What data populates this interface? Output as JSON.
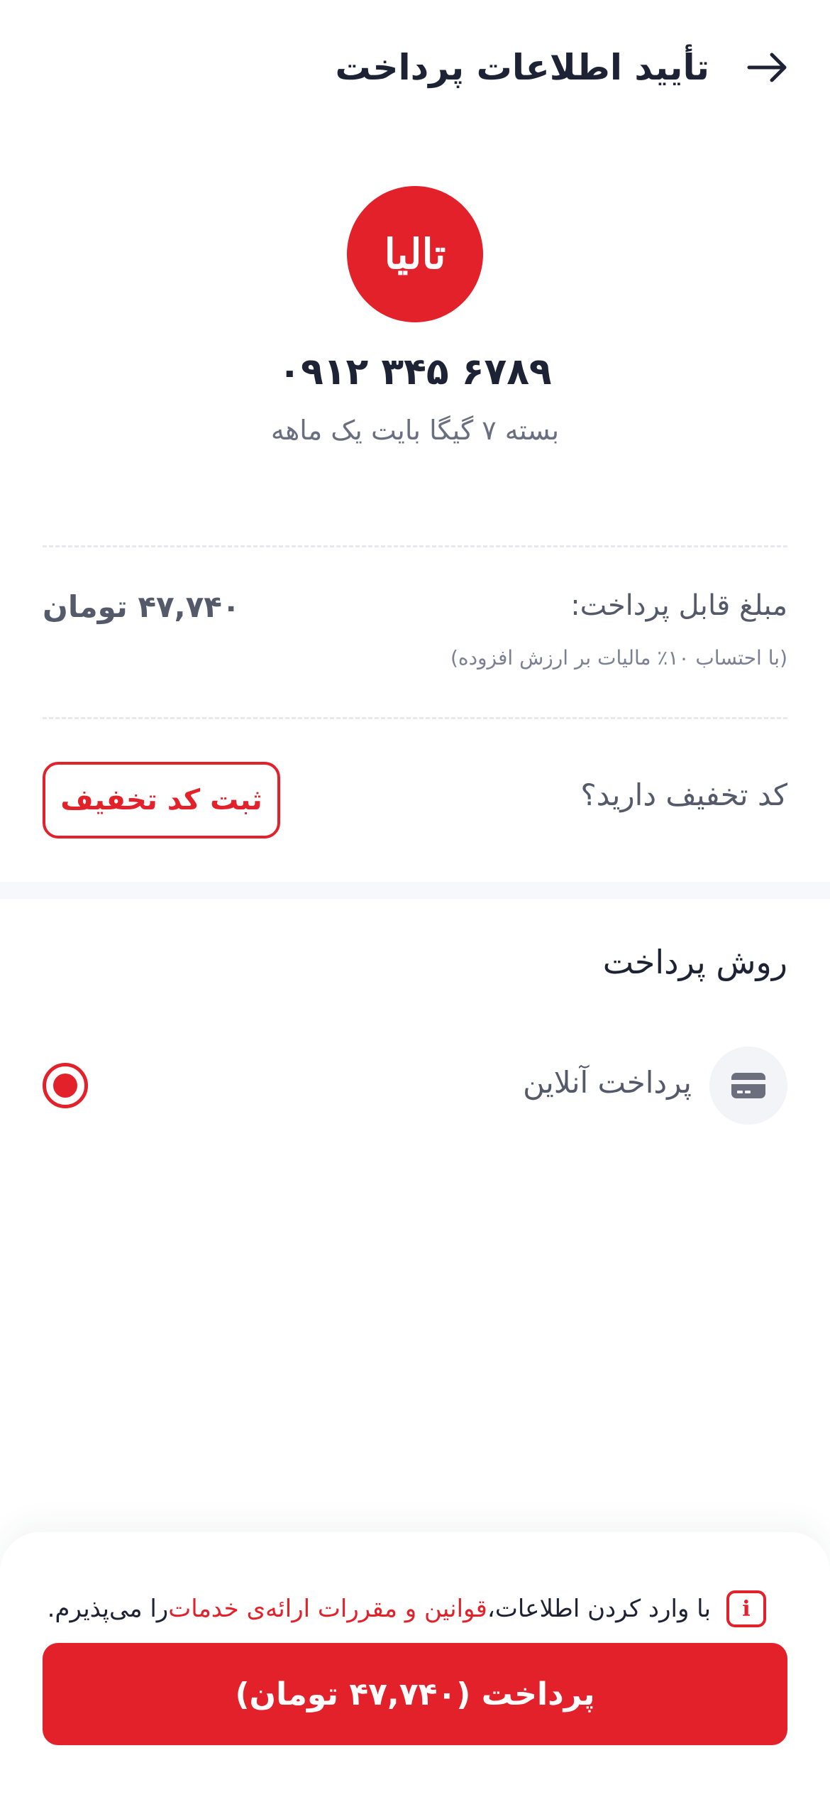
{
  "header": {
    "title": "تأیید اطلاعات پرداخت",
    "back_icon": "arrow-right-icon"
  },
  "operator": {
    "logo_text": "تالیا",
    "logo_color": "#e3212b",
    "phone": "۰۹۱۲ ۳۴۵ ۶۷۸۹",
    "package": "بسته ۷ گیگا بایت یک ماهه"
  },
  "amount": {
    "label": "مبلغ قابل پرداخت:",
    "value": "۴۷,۷۴۰ تومان",
    "note": "(با احتساب ۱۰٪ مالیات بر ارزش افزوده)"
  },
  "discount": {
    "question": "کد تخفیف دارید؟",
    "button_label": "ثبت کد تخفیف"
  },
  "payment_method": {
    "title": "روش پرداخت",
    "option_label": "پرداخت آنلاین",
    "option_icon": "credit-card-icon",
    "selected": true
  },
  "footer": {
    "terms_prefix": "با وارد کردن اطلاعات، ",
    "terms_link": "قوانین و مقررات ارائه‌ی خدمات",
    "terms_suffix": " را می‌پذیرم.",
    "info_icon_glyph": "i",
    "pay_button_label": "پرداخت (۴۷,۷۴۰ تومان)"
  },
  "colors": {
    "accent": "#e3212b",
    "text_dark": "#1e2235",
    "text_muted": "#555a6b"
  }
}
